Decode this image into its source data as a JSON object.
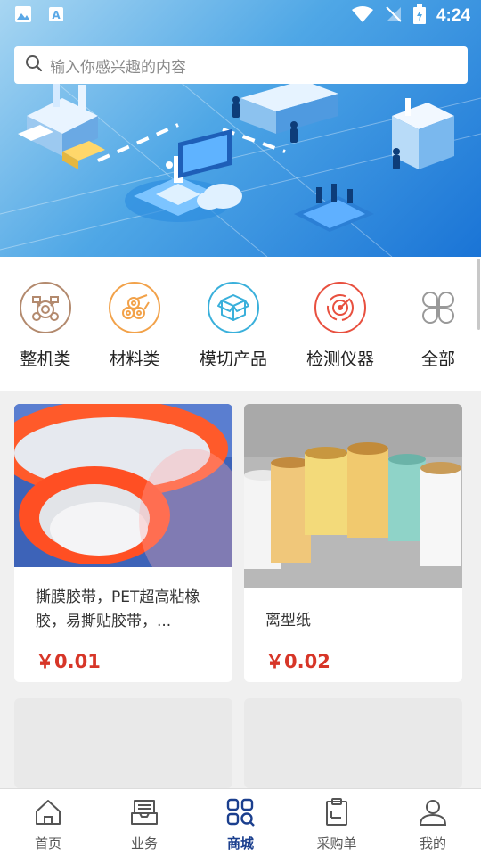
{
  "status_bar": {
    "time": "4:24",
    "icons": [
      "image-icon",
      "a-font-icon",
      "wifi-icon",
      "no-signal-icon",
      "battery-charging-icon"
    ]
  },
  "search": {
    "placeholder": "输入你感兴趣的内容",
    "icon": "search-icon"
  },
  "categories": [
    {
      "label": "整机类",
      "icon": "machine-icon",
      "color": "#b38a6e"
    },
    {
      "label": "材料类",
      "icon": "rolls-icon",
      "color": "#f2a24a"
    },
    {
      "label": "模切产品",
      "icon": "box-icon",
      "color": "#3ab0db"
    },
    {
      "label": "检测仪器",
      "icon": "radar-icon",
      "color": "#e8503f"
    },
    {
      "label": "全部",
      "icon": "grid-icon",
      "color": "#999999"
    }
  ],
  "products": [
    {
      "title": "撕膜胶带，PET超高粘橡胶，易撕贴胶带，...",
      "price": "￥0.01"
    },
    {
      "title": "离型纸",
      "price": "￥0.02"
    }
  ],
  "bottom_nav": [
    {
      "label": "首页",
      "icon": "home-icon",
      "active": false
    },
    {
      "label": "业务",
      "icon": "inbox-icon",
      "active": false
    },
    {
      "label": "商城",
      "icon": "mall-grid-icon",
      "active": true
    },
    {
      "label": "采购单",
      "icon": "clipboard-icon",
      "active": false
    },
    {
      "label": "我的",
      "icon": "user-icon",
      "active": false
    }
  ],
  "colors": {
    "price": "#d73628",
    "nav_active": "#1b3f8e",
    "hero_blue": "#1a74d6"
  }
}
